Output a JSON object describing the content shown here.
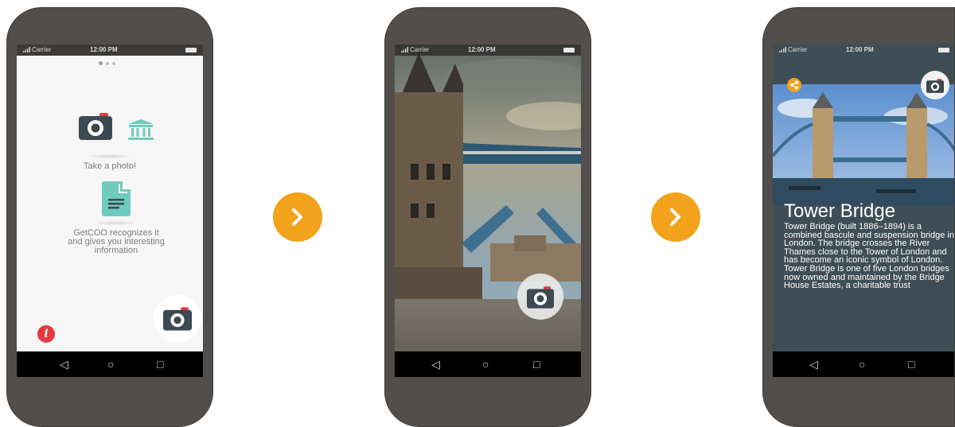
{
  "status": {
    "carrier": "Carrier",
    "time": "12:00 PM"
  },
  "screen1": {
    "step1_label": "Take a photo!",
    "step2_label": "GetCOO recognizes it and gives you interesting information"
  },
  "screen3": {
    "title": "Tower Bridge",
    "body": "Tower Bridge (built 1886–1894) is a combined bascule and suspension bridge in London. The bridge crosses the River Thames close to the Tower of London and has become an iconic symbol of London. Tower Bridge is one of five London bridges now owned and maintained by the Bridge House Estates, a charitable trust"
  },
  "colors": {
    "accent": "#f3a21b",
    "info": "#e53940",
    "teal": "#6fcbbd",
    "dark_bg": "#3f4d56"
  },
  "icons": [
    "camera-icon",
    "museum-icon",
    "document-icon",
    "info-icon",
    "share-icon",
    "chevron-right-icon",
    "back-icon",
    "home-icon",
    "recents-icon"
  ]
}
